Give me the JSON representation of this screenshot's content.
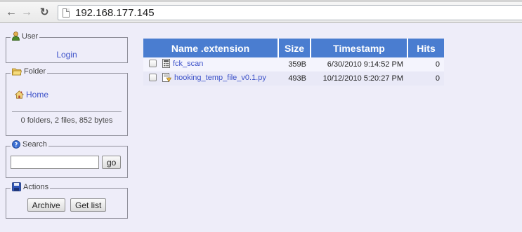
{
  "browser": {
    "url": "192.168.177.145",
    "icons": {
      "back": "arrow-left-icon",
      "forward": "arrow-right-icon",
      "reload": "reload-icon",
      "page": "page-icon"
    }
  },
  "sidebar": {
    "user": {
      "legend": "User",
      "login_label": "Login",
      "icon": "user-icon"
    },
    "folder": {
      "legend": "Folder",
      "home_label": "Home",
      "summary": "0 folders, 2 files, 852 bytes",
      "icon": "folder-icon",
      "home_icon": "home-icon"
    },
    "search": {
      "legend": "Search",
      "input_value": "",
      "go_label": "go",
      "icon": "help-icon"
    },
    "actions": {
      "legend": "Actions",
      "archive_label": "Archive",
      "getlist_label": "Get list",
      "icon": "save-icon"
    }
  },
  "table": {
    "headers": {
      "name": "Name .extension",
      "size": "Size",
      "timestamp": "Timestamp",
      "hits": "Hits"
    },
    "rows": [
      {
        "name": "fck_scan",
        "size": "359B",
        "timestamp": "6/30/2010 9:14:52 PM",
        "hits": "0",
        "icon": "calculator-file-icon"
      },
      {
        "name": "hooking_temp_file_v0.1.py",
        "size": "493B",
        "timestamp": "10/12/2010 5:20:27 PM",
        "hits": "0",
        "icon": "script-file-icon"
      }
    ]
  },
  "colors": {
    "header_bg": "#4a7dd0",
    "page_bg": "#eeedf9",
    "link": "#3d52c9"
  }
}
